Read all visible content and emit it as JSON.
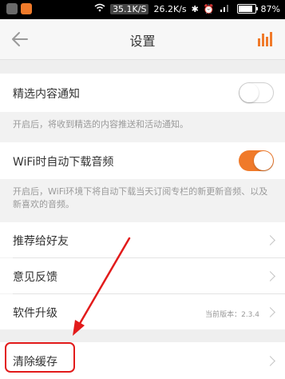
{
  "status_bar": {
    "speed_highlight": "35.1K/S",
    "speed": "26.2K/s",
    "battery_text": "87%",
    "battery_level": 0.87
  },
  "header": {
    "title": "设置"
  },
  "settings": {
    "selected_notify": {
      "label": "精选内容通知",
      "hint": "开启后，将收到精选的内容推送和活动通知。",
      "enabled": false
    },
    "wifi_download": {
      "label": "WiFi时自动下载音频",
      "hint": "开启后，WiFi环境下将自动下载当天订阅专栏的新更新音频、以及新喜欢的音频。",
      "enabled": true
    },
    "recommend": {
      "label": "推荐给好友"
    },
    "feedback": {
      "label": "意见反馈"
    },
    "upgrade": {
      "label": "软件升级",
      "version": "当前版本：2.3.4"
    },
    "clear_cache": {
      "label": "清除缓存"
    }
  },
  "colors": {
    "accent": "#f07a2a",
    "annotation": "#e21b1b"
  },
  "icons": {
    "back": "arrow-left-icon",
    "player": "equalizer-icon",
    "chevron": "chevron-right-icon"
  }
}
